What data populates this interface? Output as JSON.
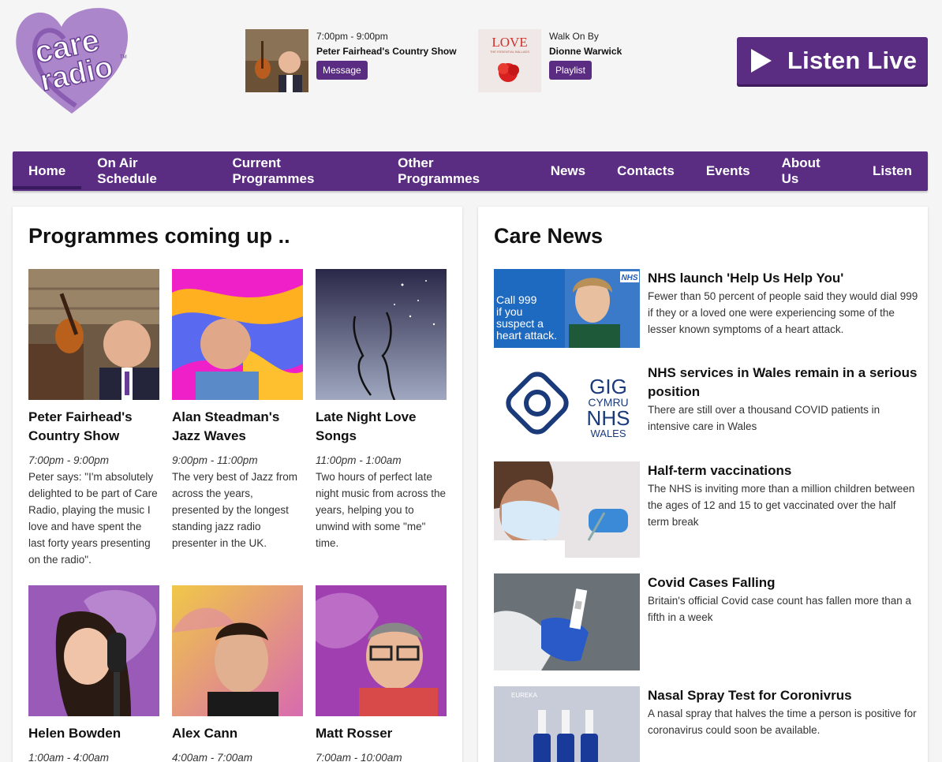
{
  "brand": {
    "logo_text_1": "care",
    "logo_text_2": "radio",
    "tm": "TM",
    "accent": "#5a2d82",
    "logo_color": "#8e5cb2"
  },
  "now_playing": {
    "show_time": "7:00pm - 9:00pm",
    "show_name": "Peter Fairhead's Country Show",
    "message_label": "Message",
    "track_title": "Walk On By",
    "track_artist": "Dionne Warwick",
    "playlist_label": "Playlist",
    "album_text": "LOVE",
    "album_sub": "THE ESSENTIAL BALLADS"
  },
  "listen_live": {
    "label": "Listen Live"
  },
  "nav": {
    "items": [
      "Home",
      "On Air Schedule",
      "Current Programmes",
      "Other Programmes",
      "News",
      "Contacts",
      "Events",
      "About Us",
      "Listen"
    ]
  },
  "programmes": {
    "heading": "Programmes coming up ..",
    "items": [
      {
        "title": "Peter Fairhead's Country Show",
        "time": "7:00pm - 9:00pm",
        "desc": "Peter says: \"I'm absolutely delighted to be part of Care Radio, playing the music I love and have spent the last forty years presenting on the radio\"."
      },
      {
        "title": "Alan Steadman's Jazz Waves",
        "time": "9:00pm - 11:00pm",
        "desc": "The very best of Jazz from across the years, presented by the longest standing jazz radio presenter in the UK."
      },
      {
        "title": "Late Night Love Songs",
        "time": "11:00pm - 1:00am",
        "desc": "Two hours of perfect late night music from across the years, helping you to unwind with some \"me\" time."
      },
      {
        "title": "Helen Bowden",
        "time": "1:00am - 4:00am",
        "desc": ""
      },
      {
        "title": "Alex Cann",
        "time": "4:00am - 7:00am",
        "desc": ""
      },
      {
        "title": "Matt Rosser",
        "time": "7:00am - 10:00am",
        "desc": ""
      }
    ]
  },
  "care_news": {
    "heading": "Care News",
    "items": [
      {
        "title": "NHS launch 'Help Us Help You'",
        "desc": "Fewer than 50 percent of people said they would dial 999 if they or a loved one were experiencing some of the lesser known symptoms of a heart attack.",
        "img_text_1": "Call 999",
        "img_text_2": "if you",
        "img_text_3": "suspect a",
        "img_text_4": "heart attack.",
        "img_badge": "NHS"
      },
      {
        "title": "NHS services in Wales remain in a serious position",
        "desc": "There are still over a thousand COVID patients in intensive care in Wales",
        "img_text_1": "GIG",
        "img_text_2": "CYMRU",
        "img_text_3": "NHS",
        "img_text_4": "WALES"
      },
      {
        "title": "Half-term vaccinations",
        "desc": "The NHS is inviting more than a million children between the ages of 12 and 15 to get vaccinated over the half term break"
      },
      {
        "title": "Covid Cases Falling",
        "desc": "Britain's official Covid case count has fallen more than a fifth in a week"
      },
      {
        "title": "Nasal Spray Test for Coronivrus",
        "desc": "A nasal spray that halves the time a person is positive for coronavirus could soon be available.",
        "img_text_1": "EUREKA"
      }
    ]
  }
}
